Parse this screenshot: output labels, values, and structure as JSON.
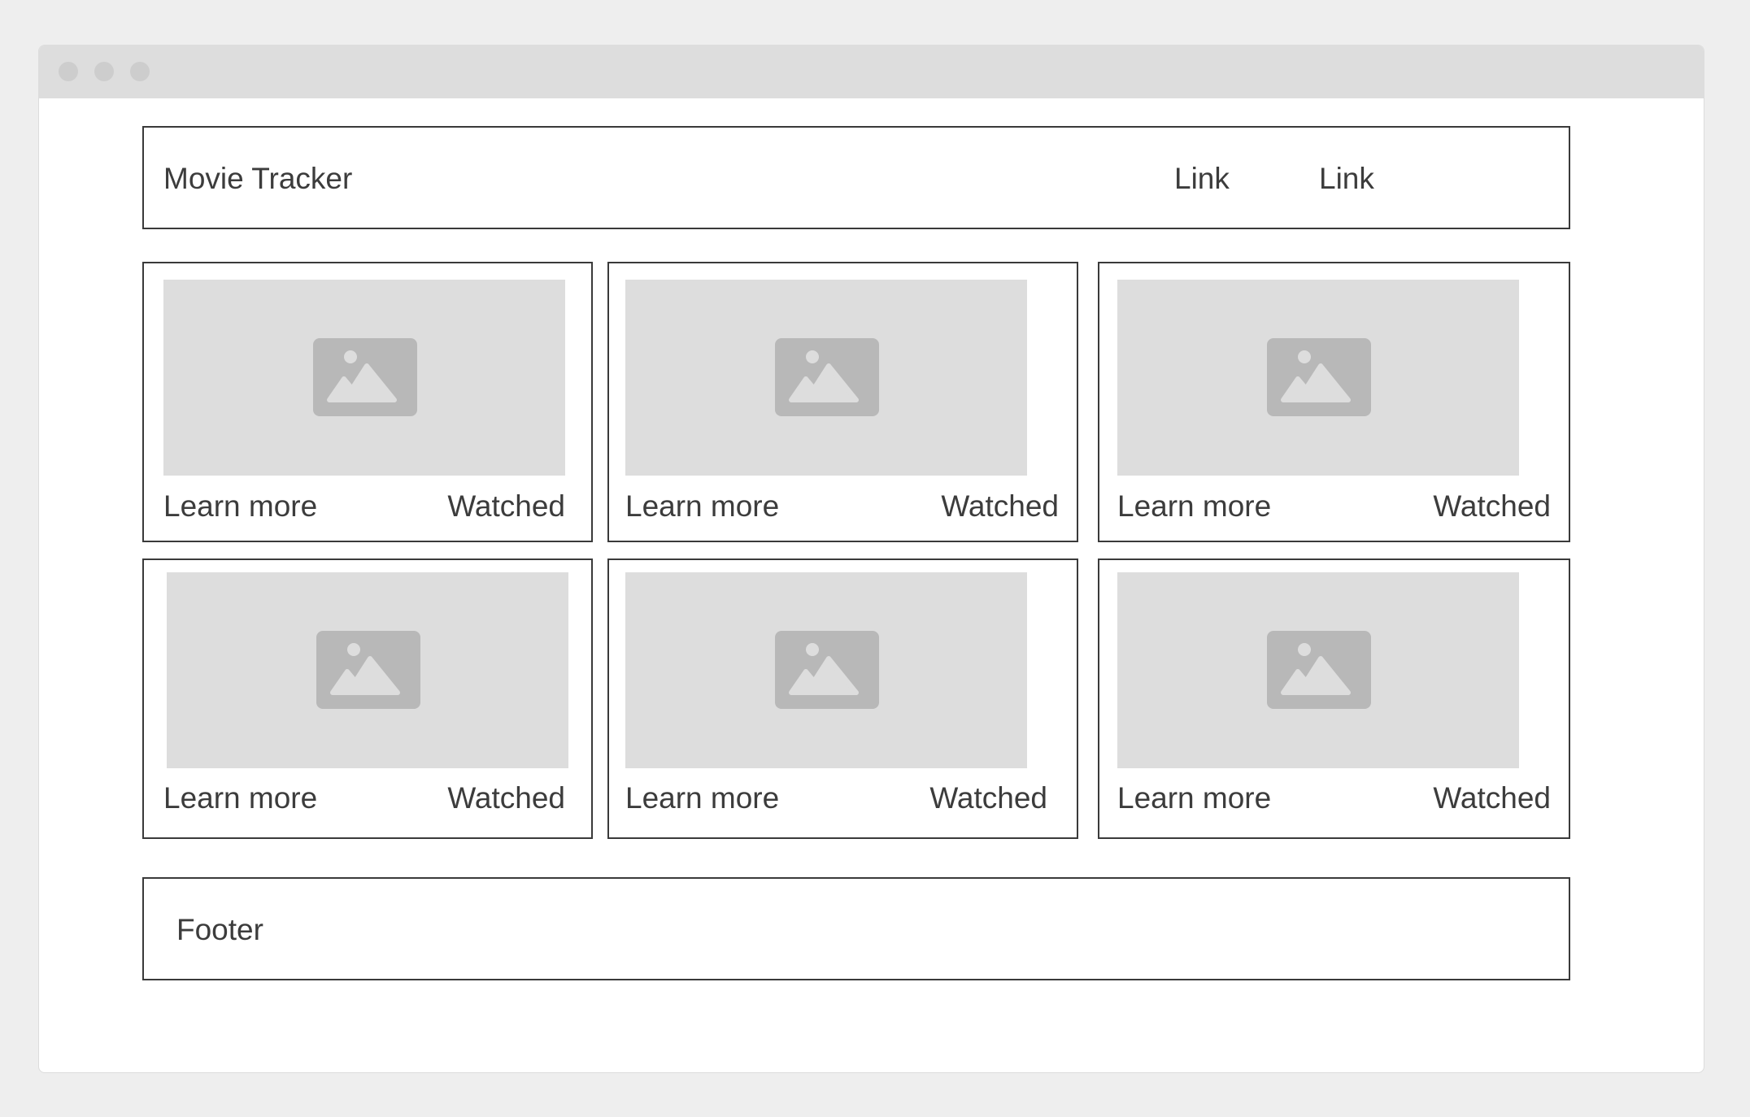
{
  "app": {
    "brand": "Movie Tracker",
    "nav_links": [
      "Link",
      "Link"
    ]
  },
  "cards": [
    {
      "learn_label": "Learn more",
      "watched_label": "Watched",
      "image_icon": "image-placeholder-icon"
    },
    {
      "learn_label": "Learn more",
      "watched_label": "Watched",
      "image_icon": "image-placeholder-icon"
    },
    {
      "learn_label": "Learn more",
      "watched_label": "Watched",
      "image_icon": "image-placeholder-icon"
    },
    {
      "learn_label": "Learn more",
      "watched_label": "Watched",
      "image_icon": "image-placeholder-icon"
    },
    {
      "learn_label": "Learn more",
      "watched_label": "Watched",
      "image_icon": "image-placeholder-icon"
    },
    {
      "learn_label": "Learn more",
      "watched_label": "Watched",
      "image_icon": "image-placeholder-icon"
    }
  ],
  "footer": {
    "text": "Footer"
  },
  "colors": {
    "page_bg": "#eeeeee",
    "window_bg": "#ffffff",
    "titlebar_bg": "#dddddd",
    "placeholder_bg": "#dddddd",
    "placeholder_icon": "#b8b8b8",
    "border": "#3a3a3a",
    "text": "#3c3c3c"
  }
}
